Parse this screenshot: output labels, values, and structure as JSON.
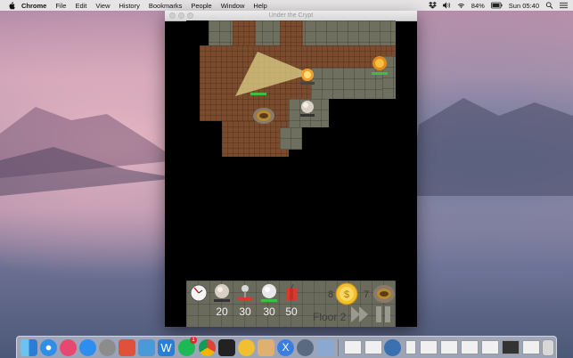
{
  "menubar": {
    "app": "Chrome",
    "menus": [
      "File",
      "Edit",
      "View",
      "History",
      "Bookmarks",
      "People",
      "Window",
      "Help"
    ],
    "battery": "84%",
    "clock": "Sun 05:40"
  },
  "window": {
    "title": "Under the Crypt"
  },
  "hud": {
    "costs": [
      "20",
      "30",
      "30",
      "50"
    ],
    "lives": "8",
    "count": "7",
    "floor": "Floor 2"
  },
  "dock": {
    "apps": [
      "finder-icon",
      "safari-icon",
      "itunes-icon",
      "app-store-icon",
      "system-preferences-icon",
      "preview-icon",
      "edit-icon",
      "w-app-icon",
      "spotify-icon",
      "chrome-icon",
      "terminal-icon",
      "pinwheel-icon",
      "toy-icon",
      "x-app-icon",
      "ghost-icon",
      "mail-icon"
    ],
    "badge": "1"
  },
  "colors": {
    "floor": "#7a4b2c",
    "wall": "#6e6f5f",
    "coin": "#f0c030",
    "green_bar": "#3fbf3f",
    "red_bar": "#d83a2e"
  }
}
